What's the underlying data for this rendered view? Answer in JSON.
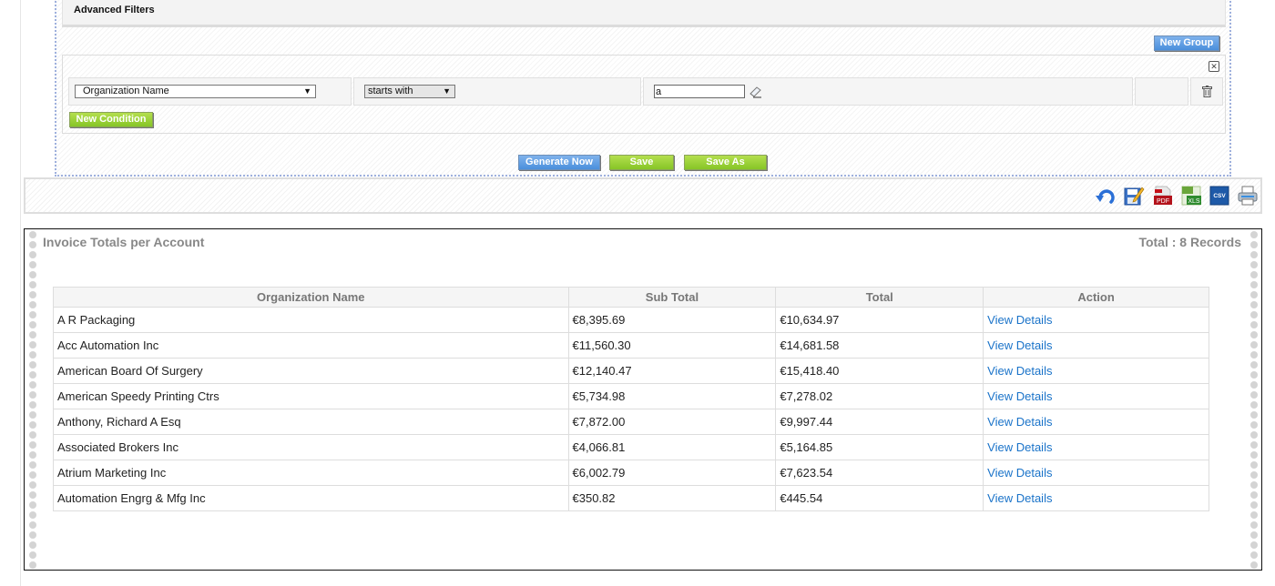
{
  "filters": {
    "title": "Advanced Filters",
    "new_group_label": "New Group",
    "close_group_icon": "close-box-icon",
    "condition": {
      "field_value": "Organization Name",
      "operator_value": "starts with",
      "input_value": "a",
      "clear_icon": "eraser-icon",
      "delete_icon": "trash-icon"
    },
    "new_condition_label": "New Condition",
    "generate_label": "Generate Now",
    "save_label": "Save",
    "save_as_label": "Save As"
  },
  "toolbar": {
    "icons": [
      "refresh-icon",
      "edit-report-icon",
      "export-pdf-icon",
      "export-xls-icon",
      "export-csv-icon",
      "print-icon"
    ],
    "pdf_text": "PDF",
    "xls_text": "XLS",
    "csv_text": "CSV"
  },
  "report": {
    "title": "Invoice Totals per Account",
    "total_text": "Total : 8 Records",
    "columns": [
      "Organization Name",
      "Sub Total",
      "Total",
      "Action"
    ],
    "rows": [
      {
        "org": "A R Packaging",
        "subtotal": "€8,395.69",
        "total": "€10,634.97",
        "action": "View Details"
      },
      {
        "org": "Acc Automation Inc",
        "subtotal": "€11,560.30",
        "total": "€14,681.58",
        "action": "View Details"
      },
      {
        "org": "American Board Of Surgery",
        "subtotal": "€12,140.47",
        "total": "€15,418.40",
        "action": "View Details"
      },
      {
        "org": "American Speedy Printing Ctrs",
        "subtotal": "€5,734.98",
        "total": "€7,278.02",
        "action": "View Details"
      },
      {
        "org": "Anthony, Richard A Esq",
        "subtotal": "€7,872.00",
        "total": "€9,997.44",
        "action": "View Details"
      },
      {
        "org": "Associated Brokers Inc",
        "subtotal": "€4,066.81",
        "total": "€5,164.85",
        "action": "View Details"
      },
      {
        "org": "Atrium Marketing Inc",
        "subtotal": "€6,002.79",
        "total": "€7,623.54",
        "action": "View Details"
      },
      {
        "org": "Automation Engrg & Mfg Inc",
        "subtotal": "€350.82",
        "total": "€445.54",
        "action": "View Details"
      }
    ]
  }
}
